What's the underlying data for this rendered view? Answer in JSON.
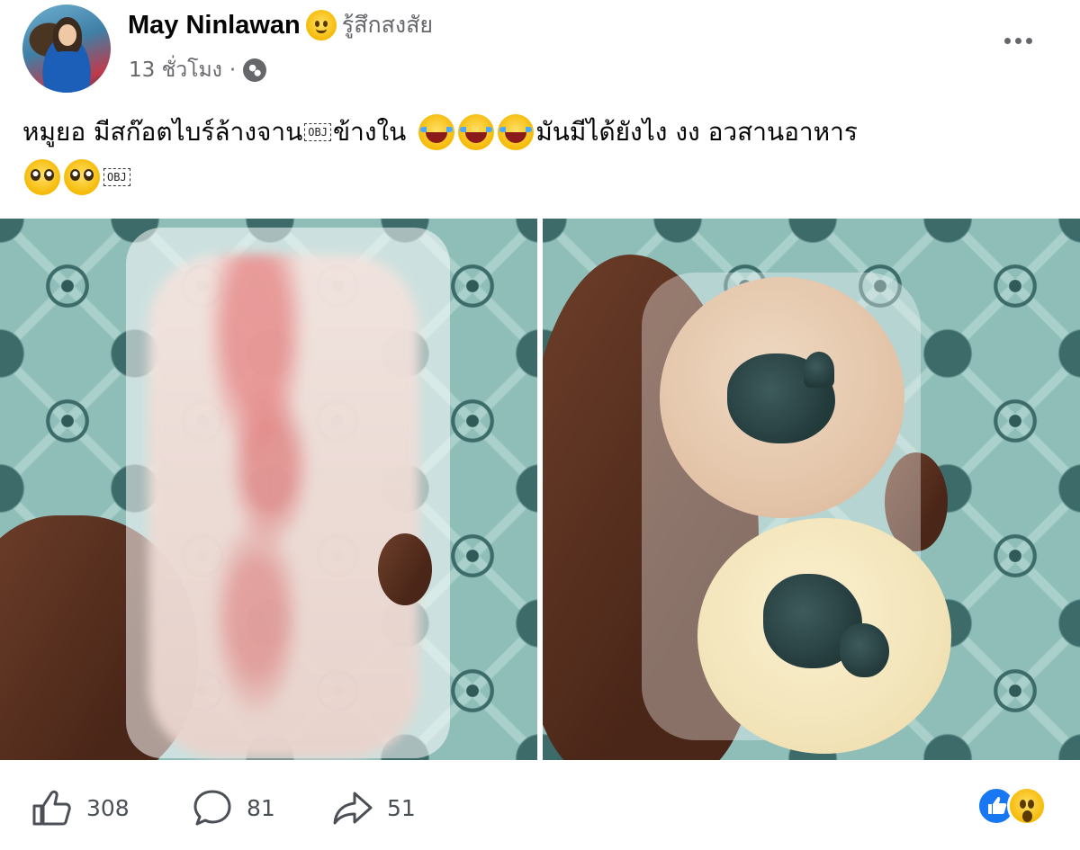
{
  "post": {
    "author": {
      "name": "May Ninlawan",
      "feeling": "รู้สึกสงสัย"
    },
    "time": "13 ชั่วโมง",
    "separator": "·",
    "text": {
      "line1_a": "หมูยอ  มีสก๊อตไบร์ล้างจาน",
      "obj1": "OBJ",
      "line1_b": "ข้างใน",
      "line1_c": "มันมีได้ยังไง งง  อวสานอาหาร",
      "obj2": "OBJ"
    }
  },
  "engagement": {
    "likes": "308",
    "comments": "81",
    "shares": "51"
  },
  "icons": {
    "author_feeling": "smiling-emoji-icon",
    "privacy": "globe-icon",
    "more": "more-options-icon",
    "like": "thumbs-up-icon",
    "comment": "comment-bubble-icon",
    "share": "share-arrow-icon",
    "reaction_like": "like-reaction-icon",
    "reaction_wow": "wow-reaction-icon"
  },
  "colors": {
    "text_primary": "#050505",
    "text_secondary": "#65676b",
    "facebook_blue": "#1877f2"
  }
}
